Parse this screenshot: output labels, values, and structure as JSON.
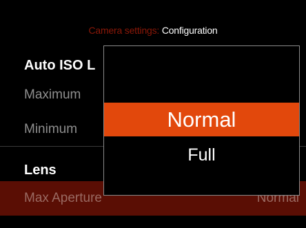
{
  "header": {
    "accent": "Camera settings:",
    "title": "Configuration"
  },
  "sections": {
    "auto_iso_label": "Auto ISO L",
    "maximum_label": "Maximum",
    "minimum_label": "Minimum",
    "lens_label": "Lens",
    "max_aperture_label": "Max Aperture",
    "max_aperture_value": "Normal"
  },
  "popup": {
    "options": [
      {
        "label": "Normal",
        "selected": true
      },
      {
        "label": "Full",
        "selected": false
      }
    ]
  },
  "colors": {
    "accent_header": "#8c1808",
    "selected_option": "#e2480c",
    "selected_row": "#5a0e04",
    "secondary_text": "#8f8f8f"
  }
}
